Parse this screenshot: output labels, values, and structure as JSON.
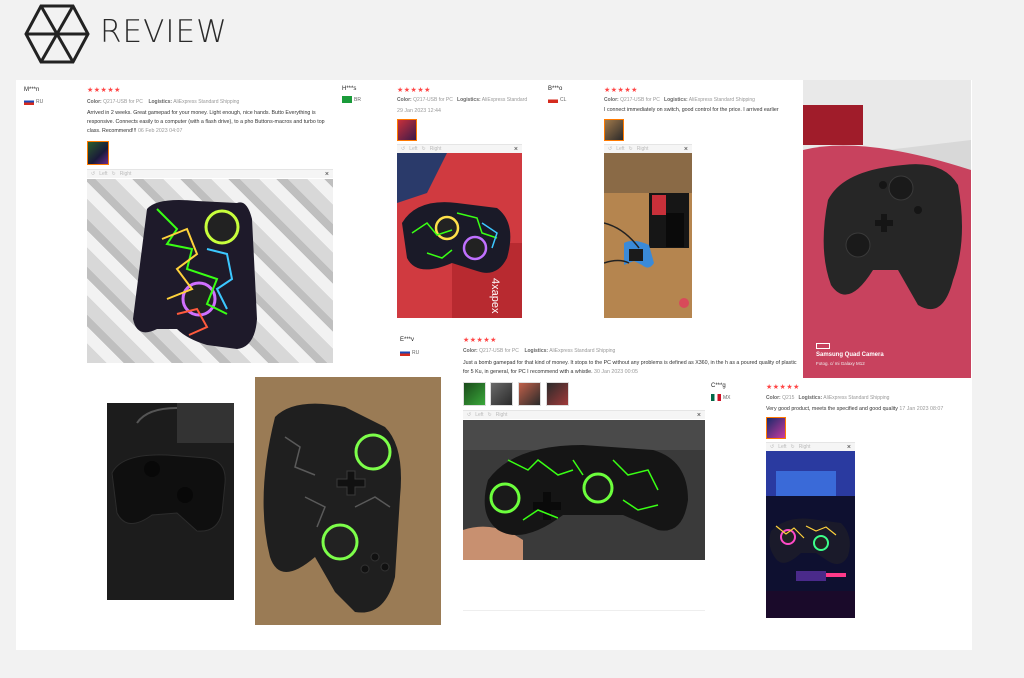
{
  "header": {
    "title": "REVIEW"
  },
  "viewer": {
    "left": "Left",
    "right": "Right",
    "close": "×"
  },
  "reviews": [
    {
      "user": "M***n",
      "country": "RU",
      "stars": "★★★★★",
      "color_label": "Color:",
      "color_value": "Q217-USB for PC",
      "logistics_label": "Logistics:",
      "logistics_value": "AliExpress Standard Shipping",
      "text": "Arrived in 2 weeks. Great gamepad for your money. Light enough, nice hands. Butto Everything is responsive. Connects easily to a computer (with a flash drive), to a pho Buttons-macros and turbo top class. Recommend!!!",
      "date": "06 Feb 2023 04:07"
    },
    {
      "user": "H***s",
      "country": "BR",
      "stars": "★★★★★",
      "color_label": "Color:",
      "color_value": "Q217-USB for PC",
      "logistics_label": "Logistics:",
      "logistics_value": "AliExpress Standard",
      "text": "",
      "date": "29 Jan 2023 12:44"
    },
    {
      "user": "B***o",
      "country": "CL",
      "stars": "★★★★★",
      "color_label": "Color:",
      "color_value": "Q217-USB for PC",
      "logistics_label": "Logistics:",
      "logistics_value": "AliExpress Standard Shipping",
      "text": "I connect immediately on switch, good control for the price. I arrived earlier",
      "date": ""
    },
    {
      "user": "E***v",
      "country": "RU",
      "stars": "★★★★★",
      "color_label": "Color:",
      "color_value": "Q217-USB for PC",
      "logistics_label": "Logistics:",
      "logistics_value": "AliExpress Standard Shipping",
      "text": "Just a bomb gamepad for that kind of money. It stops to the PC without any problems is defined as X360, in the h as a poured quality of plastic for 5 Ku, in general, for PC I recommend with a whistle.",
      "date": "30 Jan 2023 00:05"
    },
    {
      "user": "C***g",
      "country": "MX",
      "stars": "★★★★★",
      "color_label": "Color:",
      "color_value": "Q215",
      "logistics_label": "Logistics:",
      "logistics_value": "AliExpress Standard Shipping",
      "text": "Very good product, meets the specified and good quality",
      "date": "17 Jan 2023 08:07"
    }
  ],
  "camera_watermark": {
    "title": "Samsung Quad Camera",
    "subtitle": "Fotog. c/ mi Galaxy M12"
  },
  "box_text": "4xapex",
  "colors": {
    "accent": "#ff4747",
    "selected_border": "#ff7a00",
    "controller": "#1e1e1e",
    "glow_green": "#39ff14"
  }
}
